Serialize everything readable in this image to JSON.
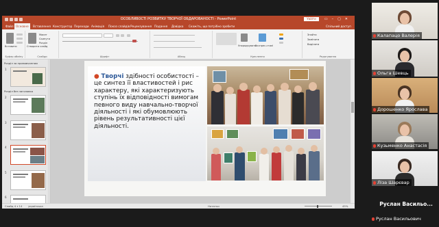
{
  "window": {
    "title": "ОСОБЛИВОСТІ РОЗВИТКУ ТВОРЧОЇ ОБДАРОВАНОСТІ - PowerPoint",
    "sign_in": "Увійти"
  },
  "ribbon": {
    "tabs": [
      "Файл",
      "Основне",
      "Вставлення",
      "Конструктор",
      "Переходи",
      "Анімація",
      "Показ слайдів",
      "Рецензування",
      "Подання",
      "Довідка",
      "Скажіть, що потрібно зробити"
    ],
    "active_tab": "Основне",
    "share": "Спільний доступ",
    "groups": [
      "Буфер обміну",
      "Слайди",
      "Шрифт",
      "Абзац",
      "Креслення",
      "Редагування"
    ],
    "buttons": {
      "paste": "Вставити",
      "new_slide": "Створити слайд",
      "layout": "Макет",
      "reset": "Скинути",
      "section": "Розділ",
      "arrange": "Упорядкувати",
      "quick_styles": "Експрес-стилі",
      "find": "Знайти",
      "replace": "Замінити",
      "select": "Виділити"
    }
  },
  "thumbnails": {
    "sections": [
      "Розділ за промовчанням",
      "Розділ без заголовка"
    ],
    "slide_numbers": [
      "1",
      "2",
      "3",
      "4",
      "5",
      "6"
    ],
    "selected": "4"
  },
  "slide": {
    "bullet": "●",
    "keyword": "Творчі",
    "text": " здібності особистості – це синтез її властивостей і рис характеру, які характеризують ступінь їх відповідності вимогам певного виду навчально-творчої діяльності і які обумовлюють рівень результативності цієї діяльності."
  },
  "status": {
    "slide_counter": "Слайд 4 з 14",
    "language": "українська",
    "notes": "Нотатки",
    "zoom": "45%"
  },
  "participants": [
    {
      "name": "Калапацо Валерія"
    },
    {
      "name": "Ольга Шевць"
    },
    {
      "name": "Дорошенко Ярослава"
    },
    {
      "name": "Кузьменко Анастасія"
    },
    {
      "name": "Ліза Шарєвар"
    },
    {
      "name": "Руслан Васильо...",
      "avatar_only": true
    },
    {
      "name": "Руслан Васильович"
    }
  ],
  "colors": {
    "ppt_accent": "#b7472a",
    "speaker_outline": "#e9ef25",
    "muted_mic": "#e34234",
    "slide_keyword": "#2b5797"
  }
}
